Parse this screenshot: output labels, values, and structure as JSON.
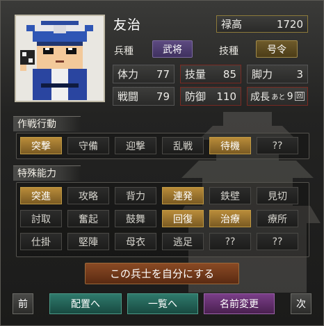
{
  "officer": {
    "name": "友治",
    "salary_label": "禄高",
    "salary_value": "1720",
    "troop_type_label": "兵種",
    "troop_type_value": "武将",
    "skill_type_label": "技種",
    "skill_type_value": "号令"
  },
  "stats": [
    {
      "label": "体力",
      "value": "77"
    },
    {
      "label": "技量",
      "value": "85"
    },
    {
      "label": "脚力",
      "value": "3"
    },
    {
      "label": "戦闘",
      "value": "79"
    },
    {
      "label": "防御",
      "value": "110"
    }
  ],
  "growth": {
    "prefix": "成長",
    "mid": "あと",
    "value": "9",
    "unit": "回"
  },
  "tactics": {
    "title": "作戦行動",
    "items": [
      {
        "label": "突撃",
        "active": true
      },
      {
        "label": "守備",
        "active": false
      },
      {
        "label": "迎撃",
        "active": false
      },
      {
        "label": "乱戦",
        "active": false
      },
      {
        "label": "待機",
        "active": true
      },
      {
        "label": "??",
        "active": false
      }
    ]
  },
  "abilities": {
    "title": "特殊能力",
    "rows": [
      [
        {
          "label": "突進",
          "active": true
        },
        {
          "label": "攻略",
          "active": false
        },
        {
          "label": "背力",
          "active": false
        },
        {
          "label": "連発",
          "active": true
        },
        {
          "label": "鉄壁",
          "active": false
        },
        {
          "label": "見切",
          "active": false
        }
      ],
      [
        {
          "label": "討取",
          "active": false
        },
        {
          "label": "奮起",
          "active": false
        },
        {
          "label": "鼓舞",
          "active": false
        },
        {
          "label": "回復",
          "active": true
        },
        {
          "label": "治療",
          "active": true
        },
        {
          "label": "療所",
          "active": false
        }
      ],
      [
        {
          "label": "仕掛",
          "active": false
        },
        {
          "label": "堅陣",
          "active": false
        },
        {
          "label": "母衣",
          "active": false
        },
        {
          "label": "逃足",
          "active": false
        },
        {
          "label": "??",
          "active": false
        },
        {
          "label": "??",
          "active": false
        }
      ]
    ]
  },
  "actions": {
    "make_own": "この兵士を自分にする",
    "prev": "前",
    "deploy": "配置へ",
    "list": "一覧へ",
    "rename": "名前変更",
    "next": "次"
  },
  "colors": {
    "active_gold": "#b98c3a",
    "troop_chip": "#4b3a6a",
    "rename_purple": "#5a2f66",
    "teal_button": "#1f5a52",
    "make_own_orange": "#7a3c1c"
  }
}
